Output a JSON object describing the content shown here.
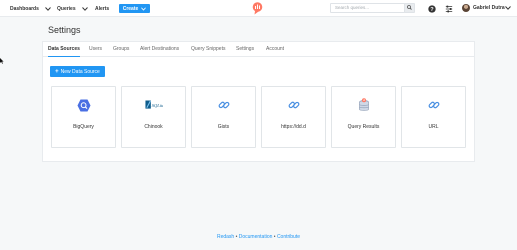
{
  "nav": {
    "dashboards": "Dashboards",
    "queries": "Queries",
    "alerts": "Alerts",
    "create": "Create"
  },
  "search": {
    "placeholder": "Search queries..."
  },
  "user": {
    "name": "Gabriel Dutra"
  },
  "page": {
    "title": "Settings"
  },
  "tabs": [
    "Data Sources",
    "Users",
    "Groups",
    "Alert Destinations",
    "Query Snippets",
    "Settings",
    "Account"
  ],
  "new_data_source": {
    "plus": "+",
    "label": "New Data Source"
  },
  "data_sources": [
    {
      "label": "BigQuery",
      "icon": "bigquery-icon"
    },
    {
      "label": "Chinook",
      "icon": "sqlite-icon"
    },
    {
      "label": "Gists",
      "icon": "link-icon"
    },
    {
      "label": "https://dd.d",
      "icon": "link-icon"
    },
    {
      "label": "Query Results",
      "icon": "database-icon"
    },
    {
      "label": "URL",
      "icon": "link-icon"
    }
  ],
  "footer": {
    "redash": "Redash",
    "sep": "•",
    "documentation": "Documentation",
    "contribute": "Contribute"
  },
  "colors": {
    "accent": "#2196f3",
    "logo": "#ff7964"
  }
}
